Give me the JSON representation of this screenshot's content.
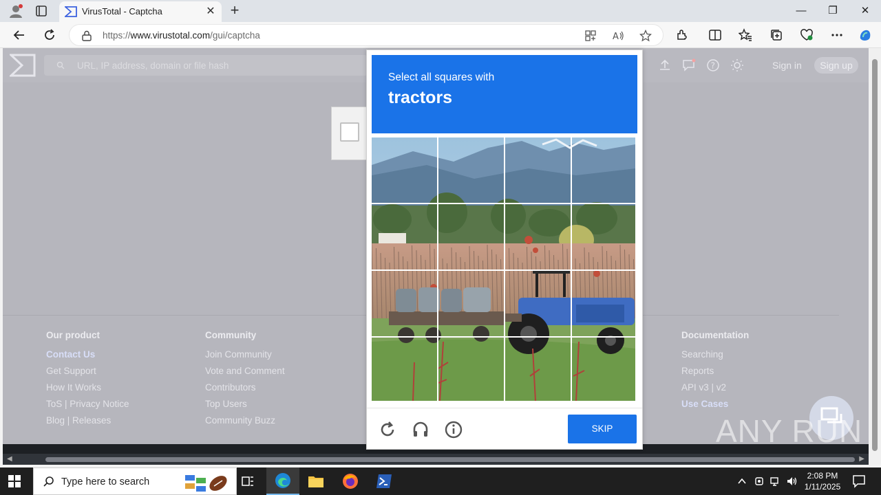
{
  "browser": {
    "tab_title": "VirusTotal - Captcha",
    "url_prefix": "https://",
    "url_host": "www.virustotal.com",
    "url_path": "/gui/captcha"
  },
  "vt": {
    "search_placeholder": "URL, IP address, domain or file hash",
    "sign_in": "Sign in",
    "sign_up": "Sign up"
  },
  "footer": {
    "col1": {
      "head": "Our product",
      "links": [
        "Contact Us",
        "Get Support",
        "How It Works",
        "ToS | Privacy Notice",
        "Blog | Releases"
      ]
    },
    "col2": {
      "head": "Community",
      "links": [
        "Join Community",
        "Vote and Comment",
        "Contributors",
        "Top Users",
        "Community Buzz"
      ]
    },
    "col5": {
      "head": "Documentation",
      "links": [
        "Searching",
        "Reports",
        "API v3 | v2",
        "Use Cases"
      ]
    }
  },
  "challenge": {
    "prompt": "Select all squares with",
    "target": "tractors",
    "skip_label": "SKIP"
  },
  "watermark": "ANY RUN",
  "taskbar": {
    "search_text": "Type here to search",
    "time": "2:08 PM",
    "date": "1/11/2025"
  },
  "colors": {
    "accent": "#1a73e8",
    "page_overlay": "#b6b6bd"
  }
}
